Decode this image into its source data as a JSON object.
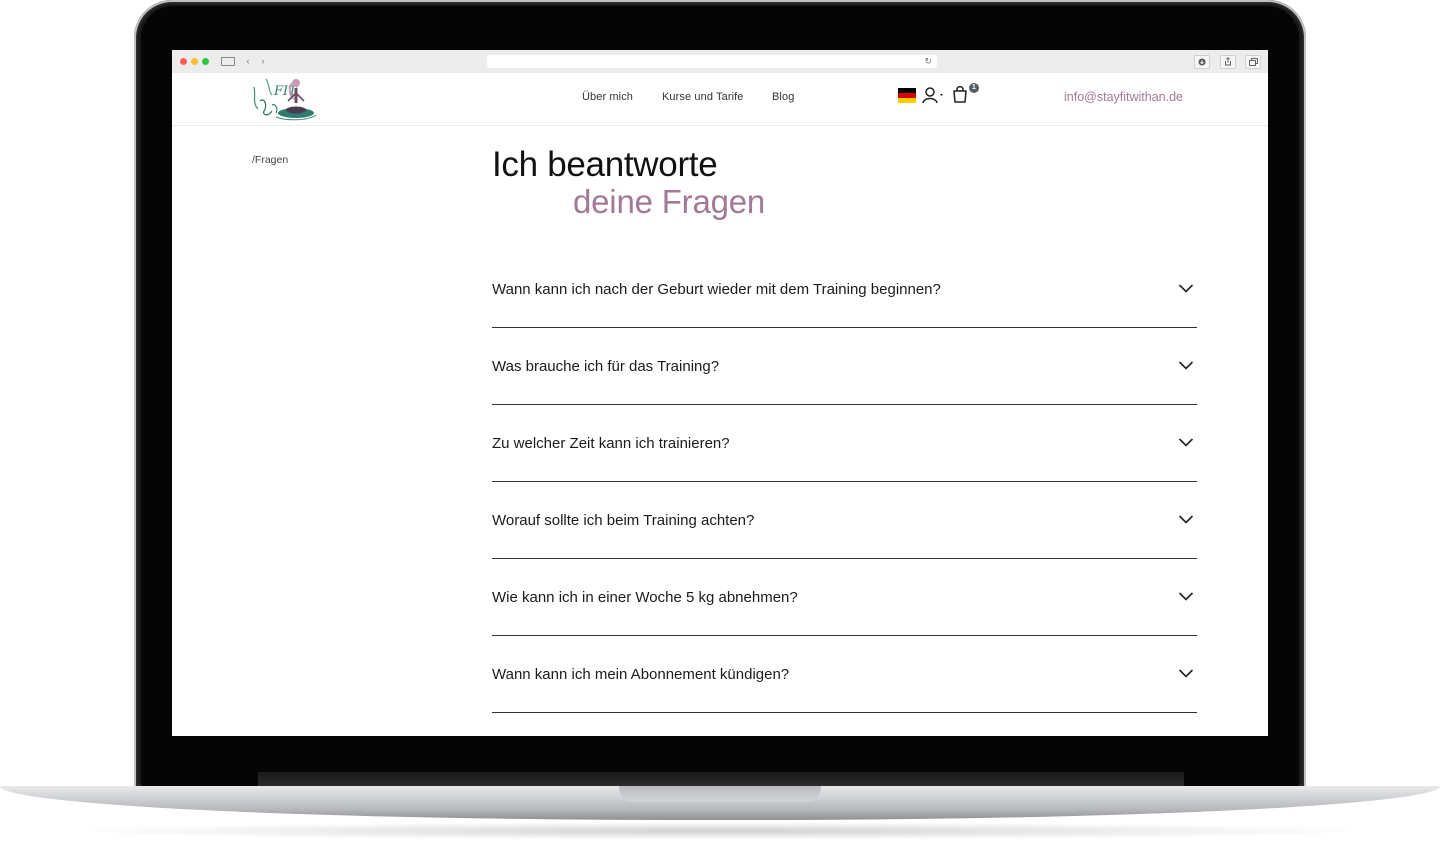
{
  "browser": {
    "reload_glyph": "↻",
    "back_glyph": "‹",
    "forward_glyph": "›"
  },
  "header": {
    "nav": [
      {
        "label": "Über mich"
      },
      {
        "label": "Kurse und Tarife"
      },
      {
        "label": "Blog"
      }
    ],
    "cart_count": "1",
    "email": "info@stayfitwithan.de"
  },
  "breadcrumb": "/Fragen",
  "headline": {
    "line1": "Ich beantworte",
    "line2": "deine Fragen"
  },
  "faq": [
    {
      "question": "Wann kann ich nach der Geburt wieder mit dem Training beginnen?"
    },
    {
      "question": "Was brauche ich für das Training?"
    },
    {
      "question": "Zu welcher Zeit kann ich trainieren?"
    },
    {
      "question": "Worauf sollte ich beim Training achten?"
    },
    {
      "question": "Wie kann ich in einer Woche 5 kg abnehmen?"
    },
    {
      "question": "Wann kann ich mein Abonnement kündigen?"
    }
  ],
  "colors": {
    "accent": "#a27a95",
    "text": "#1b1b1b",
    "flag": [
      "#000000",
      "#dd0000",
      "#ffce00"
    ]
  },
  "icons": [
    "user-icon",
    "cart-icon",
    "chevron-down-icon",
    "german-flag-icon",
    "logo"
  ]
}
